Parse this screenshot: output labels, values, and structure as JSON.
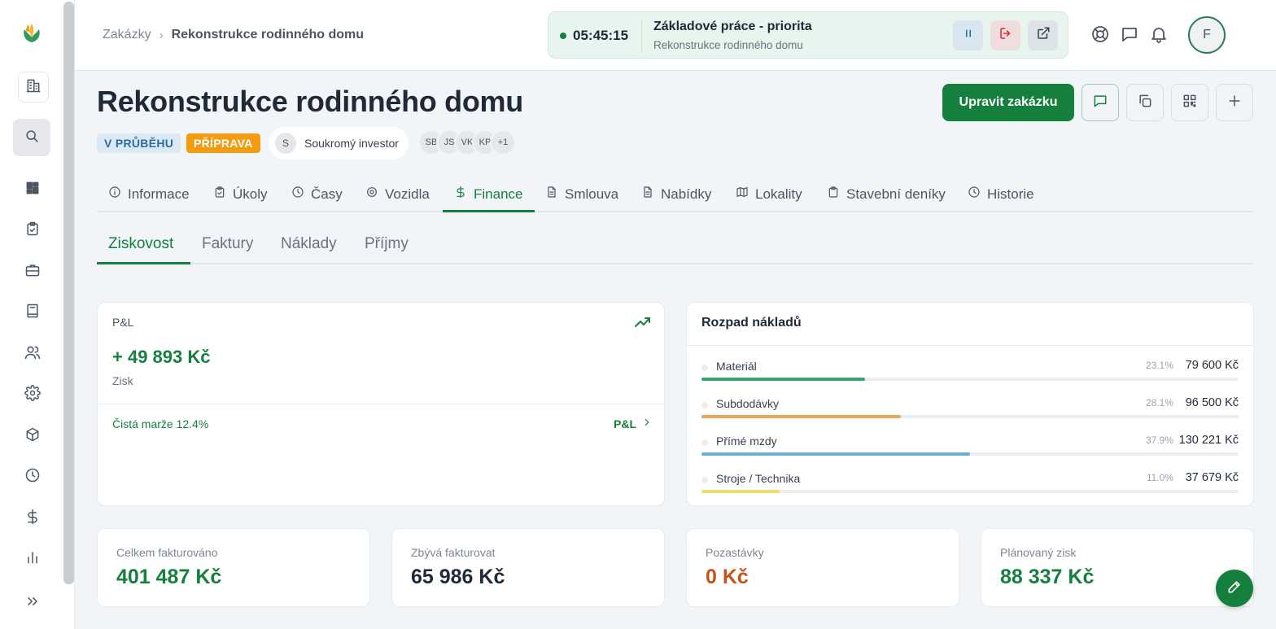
{
  "colors": {
    "accent": "#15803d",
    "running": "#2b6ca3",
    "prep": "#f39c12",
    "retention": "#c2531a"
  },
  "breadcrumb": {
    "root": "Zakázky",
    "current": "Rekonstrukce rodinného domu"
  },
  "timer": {
    "time": "05:45:15",
    "task": "Základové práce - priorita",
    "project": "Rekonstrukce rodinného domu"
  },
  "user": {
    "initial": "F"
  },
  "project": {
    "title": "Rekonstrukce rodinného domu",
    "status": "V PRŮBĚHU",
    "phase": "PŘÍPRAVA",
    "investor_initial": "S",
    "investor": "Soukromý investor",
    "people": [
      "SB",
      "JS",
      "VK",
      "KP",
      "+1"
    ]
  },
  "actions": {
    "edit": "Upravit zakázku"
  },
  "tabs": [
    "Informace",
    "Úkoly",
    "Časy",
    "Vozidla",
    "Finance",
    "Smlouva",
    "Nabídky",
    "Lokality",
    "Stavební deníky",
    "Historie"
  ],
  "active_tab": "Finance",
  "subtabs": [
    "Ziskovost",
    "Faktury",
    "Náklady",
    "Příjmy"
  ],
  "active_subtab": "Ziskovost",
  "pl": {
    "label": "P&L",
    "value": "+ 49 893 Kč",
    "sub": "Zisk",
    "margin": "Čistá marže 12.4%",
    "link": "P&L"
  },
  "costs": {
    "title": "Rozpad nákladů",
    "items": [
      {
        "name": "Materiál",
        "pct": "23.1%",
        "amount": "79 600 Kč",
        "share": 0.231,
        "color": "#3aa372"
      },
      {
        "name": "Subdodávky",
        "pct": "28.1%",
        "amount": "96 500 Kč",
        "share": 0.281,
        "color": "#e9a55a"
      },
      {
        "name": "Přímé mzdy",
        "pct": "37.9%",
        "amount": "130 221 Kč",
        "share": 0.379,
        "color": "#6ab0d0"
      },
      {
        "name": "Stroje / Technika",
        "pct": "11.0%",
        "amount": "37 679 Kč",
        "share": 0.11,
        "color": "#f2dc6a"
      }
    ]
  },
  "stats": [
    {
      "label": "Celkem fakturováno",
      "value": "401 487 Kč",
      "color": "#15803d"
    },
    {
      "label": "Zbývá fakturovat",
      "value": "65 986 Kč",
      "color": "#1f2937"
    },
    {
      "label": "Pozastávky",
      "value": "0 Kč",
      "color": "#c2531a"
    },
    {
      "label": "Plánovaný zisk",
      "value": "88 337 Kč",
      "color": "#15803d"
    }
  ]
}
